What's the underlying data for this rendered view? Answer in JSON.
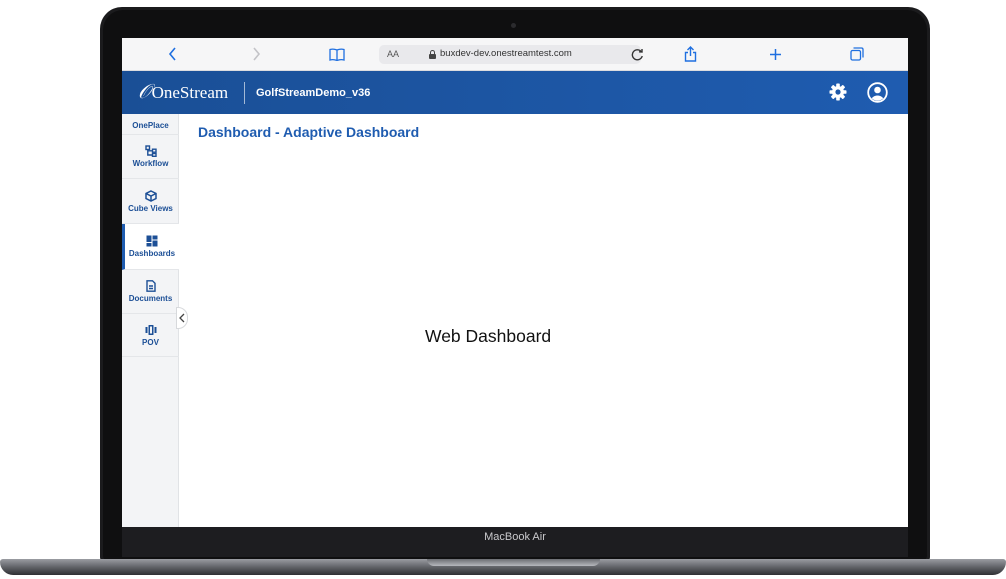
{
  "device": {
    "model_label": "MacBook Air"
  },
  "browser": {
    "address_aa": "AA",
    "url": "buxdev-dev.onestreamtest.com",
    "icons": {
      "back": "chevron-left-icon",
      "forward": "chevron-right-icon",
      "bookmarks": "book-icon",
      "reload": "reload-icon",
      "share": "share-icon",
      "new_tab": "plus-icon",
      "tabs": "tabs-icon"
    }
  },
  "app": {
    "logo_text": "OneStream",
    "app_name": "GolfStreamDemo_v36",
    "brand_color": "#1f5cb0",
    "header_icons": [
      "gear-icon",
      "user-icon"
    ]
  },
  "nav": {
    "items": [
      {
        "label": "OnePlace",
        "icon": ""
      },
      {
        "label": "Workflow",
        "icon": "workflow-icon"
      },
      {
        "label": "Cube Views",
        "icon": "cube-icon"
      },
      {
        "label": "Dashboards",
        "icon": "dashboard-icon",
        "active": true
      },
      {
        "label": "Documents",
        "icon": "document-icon"
      },
      {
        "label": "POV",
        "icon": "pov-icon"
      }
    ]
  },
  "main": {
    "title": "Dashboard - Adaptive Dashboard",
    "body_text": "Web Dashboard"
  }
}
